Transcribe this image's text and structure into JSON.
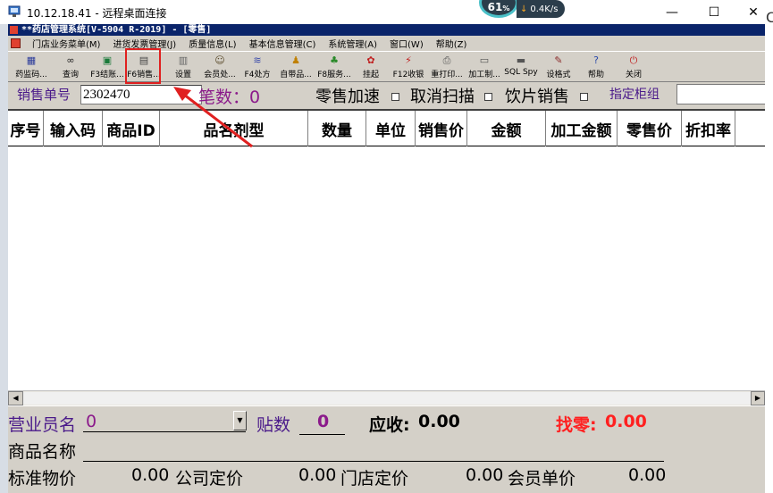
{
  "rdp": {
    "title": "10.12.18.41 - 远程桌面连接",
    "cpu_percent": "61",
    "cpu_unit": "%",
    "net_speed": "0.4K/s",
    "minimize": "—",
    "maximize": "☐",
    "close": "✕",
    "right_edge_letter": "C"
  },
  "app": {
    "title": "**药店管理系统[V-5904 R-2019] - [零售]",
    "menu": [
      "门店业务菜单(M)",
      "进货发票管理(J)",
      "质量信息(L)",
      "基本信息管理(C)",
      "系统管理(A)",
      "窗口(W)",
      "帮助(Z)"
    ],
    "toolbar": [
      {
        "label": "药监码...",
        "icon": "grid-icon",
        "glyph": "▦",
        "color": "#2a3a9a"
      },
      {
        "label": "查询",
        "icon": "binoculars-icon",
        "glyph": "👀",
        "color": "#222"
      },
      {
        "label": "F3结账...",
        "icon": "cash-icon",
        "glyph": "▣",
        "color": "#1a7a3a"
      },
      {
        "label": "F6销售...",
        "icon": "book-icon",
        "glyph": "▤",
        "color": "#444"
      },
      {
        "label": "设置",
        "icon": "settings-icon",
        "glyph": "▥",
        "color": "#666"
      },
      {
        "label": "会员处...",
        "icon": "member-icon",
        "glyph": "☺",
        "color": "#5a4a2a"
      },
      {
        "label": "F4处方",
        "icon": "prescription-icon",
        "glyph": "≋",
        "color": "#3a4aaa"
      },
      {
        "label": "自带品...",
        "icon": "person-icon",
        "glyph": "♟",
        "color": "#c08000"
      },
      {
        "label": "F8服务...",
        "icon": "money-bag-icon",
        "glyph": "♣",
        "color": "#2a8a2a"
      },
      {
        "label": "挂起",
        "icon": "suspend-icon",
        "glyph": "✿",
        "color": "#c02020"
      },
      {
        "label": "F12收银",
        "icon": "lightning-icon",
        "glyph": "⚡",
        "color": "#c02020"
      },
      {
        "label": "重打印...",
        "icon": "printer-icon",
        "glyph": "⎙",
        "color": "#555"
      },
      {
        "label": "加工制...",
        "icon": "document-icon",
        "glyph": "▭",
        "color": "#555"
      },
      {
        "label": "SQL Spy",
        "icon": "database-icon",
        "glyph": "▬",
        "color": "#555"
      },
      {
        "label": "设格式",
        "icon": "pencil-icon",
        "glyph": "✎",
        "color": "#8a2a2a"
      },
      {
        "label": "帮助",
        "icon": "help-icon",
        "glyph": "?",
        "color": "#2a4aaa"
      },
      {
        "label": "关闭",
        "icon": "close-app-icon",
        "glyph": "⏻",
        "color": "#c02020"
      }
    ]
  },
  "entry": {
    "sale_no_label": "销售单号",
    "sale_no_value": "2302470",
    "count_label": "笔数：0",
    "fast_retail_label": "零售加速",
    "cancel_scan_label": "取消扫描",
    "decoction_label": "饮片销售",
    "counter_label": "指定柜组",
    "counter_value": ""
  },
  "grid": {
    "columns": [
      "序号",
      "输入码",
      "商品ID",
      "品名剂型",
      "数量",
      "单位",
      "销售价",
      "金额",
      "加工金额",
      "零售价",
      "折扣率"
    ],
    "rows": []
  },
  "bottom": {
    "employee_label": "营业员名",
    "employee_value": "0",
    "posts_label": "贴数",
    "posts_value": "0",
    "receivable_label": "应收:",
    "receivable_value": "0.00",
    "change_label": "找零:",
    "change_value": "0.00",
    "product_name_label": "商品名称",
    "product_name_value": "",
    "row3": [
      {
        "label": "标准物价",
        "value": "0.00"
      },
      {
        "label": "公司定价",
        "value": "0.00"
      },
      {
        "label": "门店定价",
        "value": "0.00"
      },
      {
        "label": "会员单价",
        "value": "0.00"
      }
    ]
  },
  "colors": {
    "app_title_bg": "#0a246a",
    "panel_bg": "#d4d0c8",
    "purple_label": "#4a1a8a",
    "magenta_value": "#8b1a8b",
    "change_red": "#ff2020",
    "annotation_red": "#e02020"
  }
}
